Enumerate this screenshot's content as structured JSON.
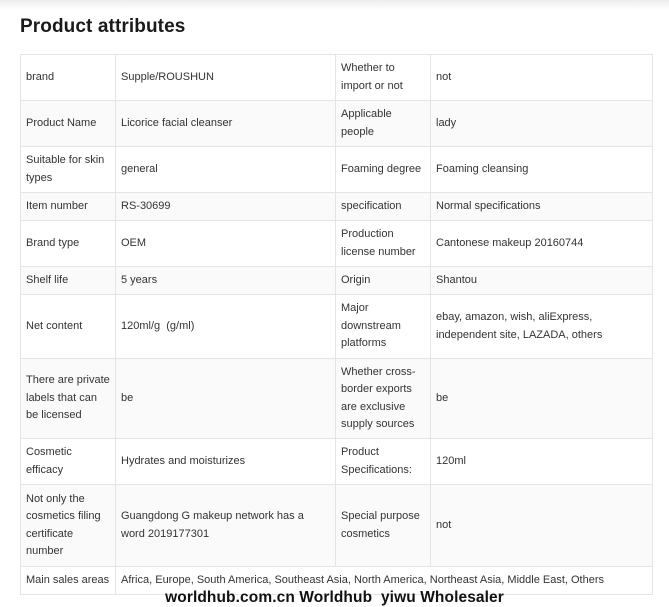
{
  "title": "Product attributes",
  "rows": [
    {
      "k1": "brand",
      "v1": "Supple/ROUSHUN",
      "k2": "Whether to import or not",
      "v2": "not"
    },
    {
      "k1": "Product Name",
      "v1": "Licorice facial cleanser",
      "k2": "Applicable people",
      "v2": "lady"
    },
    {
      "k1": "Suitable for skin types",
      "v1": "general",
      "k2": "Foaming degree",
      "v2": "Foaming cleansing"
    },
    {
      "k1": "Item number",
      "v1": "RS-30699",
      "k2": "specification",
      "v2": "Normal specifications"
    },
    {
      "k1": "Brand type",
      "v1": "OEM",
      "k2": "Production license number",
      "v2": "Cantonese makeup 20160744"
    },
    {
      "k1": "Shelf life",
      "v1": "5 years",
      "k2": "Origin",
      "v2": "Shantou"
    },
    {
      "k1": "Net content",
      "v1": "120ml/g  (g/ml)",
      "k2": "Major downstream platforms",
      "v2": "ebay, amazon, wish, aliExpress, independent site, LAZADA, others"
    },
    {
      "k1": "There are private labels that can be licensed",
      "v1": "be",
      "k2": "Whether cross-border exports are exclusive supply sources",
      "v2": "be"
    },
    {
      "k1": "Cosmetic efficacy",
      "v1": "Hydrates and moisturizes",
      "k2": "Product Specifications:",
      "v2": "120ml"
    },
    {
      "k1": "Not only the cosmetics filing certificate number",
      "v1": "Guangdong G makeup network has a word 2019177301",
      "k2": "Special purpose cosmetics",
      "v2": "not"
    }
  ],
  "last_row": {
    "k1": "Main sales areas",
    "v1": "Africa, Europe, South America, Southeast Asia, North America, Northeast Asia, Middle East, Others"
  },
  "watermark": "worldhub.com.cn Worldhub  yiwu Wholesaler"
}
